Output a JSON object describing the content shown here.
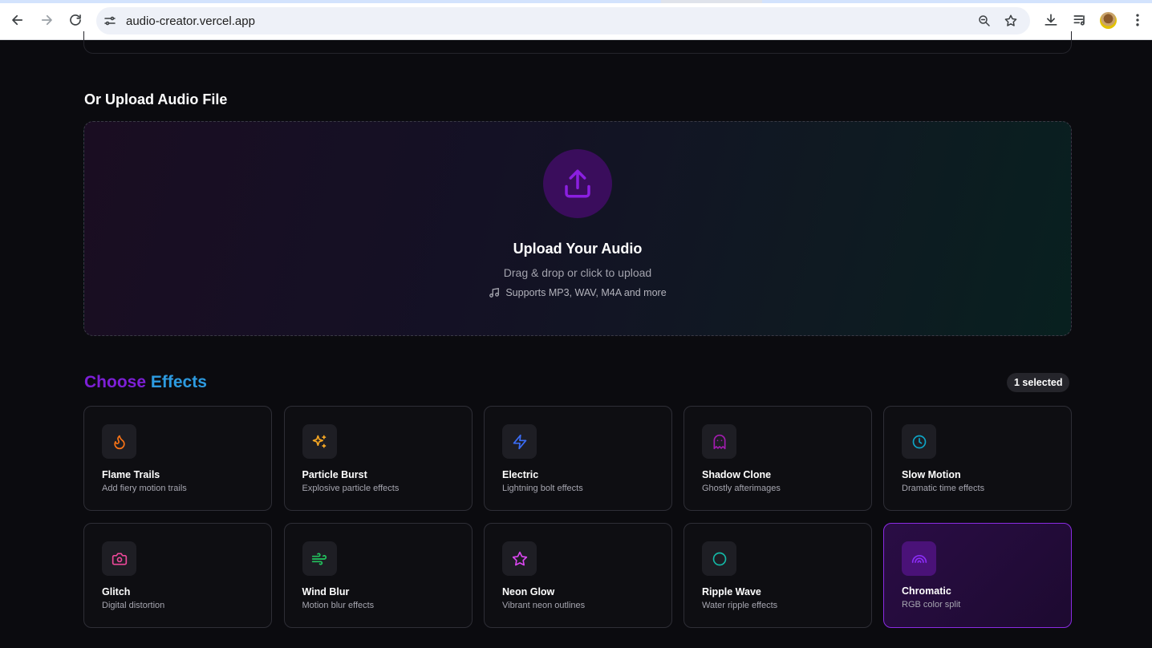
{
  "browser": {
    "url": "audio-creator.vercel.app"
  },
  "upload": {
    "section_title": "Or Upload Audio File",
    "title": "Upload Your Audio",
    "subtitle": "Drag & drop or click to upload",
    "support": "Supports MP3, WAV, M4A and more"
  },
  "effects": {
    "title_part1": "Choose",
    "title_part2": "Effects",
    "selected_badge": "1 selected",
    "items": [
      {
        "name": "Flame Trails",
        "desc": "Add fiery motion trails",
        "icon": "flame-icon",
        "color": "#f97316"
      },
      {
        "name": "Particle Burst",
        "desc": "Explosive particle effects",
        "icon": "sparkles-icon",
        "color": "#f5a623"
      },
      {
        "name": "Electric",
        "desc": "Lightning bolt effects",
        "icon": "zap-icon",
        "color": "#3b6df6"
      },
      {
        "name": "Shadow Clone",
        "desc": "Ghostly afterimages",
        "icon": "ghost-icon",
        "color": "#a21caf"
      },
      {
        "name": "Slow Motion",
        "desc": "Dramatic time effects",
        "icon": "clock-icon",
        "color": "#0ea5c6"
      },
      {
        "name": "Glitch",
        "desc": "Digital distortion",
        "icon": "camera-icon",
        "color": "#ec4899"
      },
      {
        "name": "Wind Blur",
        "desc": "Motion blur effects",
        "icon": "wind-icon",
        "color": "#22c55e"
      },
      {
        "name": "Neon Glow",
        "desc": "Vibrant neon outlines",
        "icon": "star-icon",
        "color": "#d946ef"
      },
      {
        "name": "Ripple Wave",
        "desc": "Water ripple effects",
        "icon": "circle-icon",
        "color": "#14b8a6"
      },
      {
        "name": "Chromatic",
        "desc": "RGB color split",
        "icon": "rainbow-icon",
        "color": "#8b2cf5",
        "selected": true
      }
    ]
  }
}
